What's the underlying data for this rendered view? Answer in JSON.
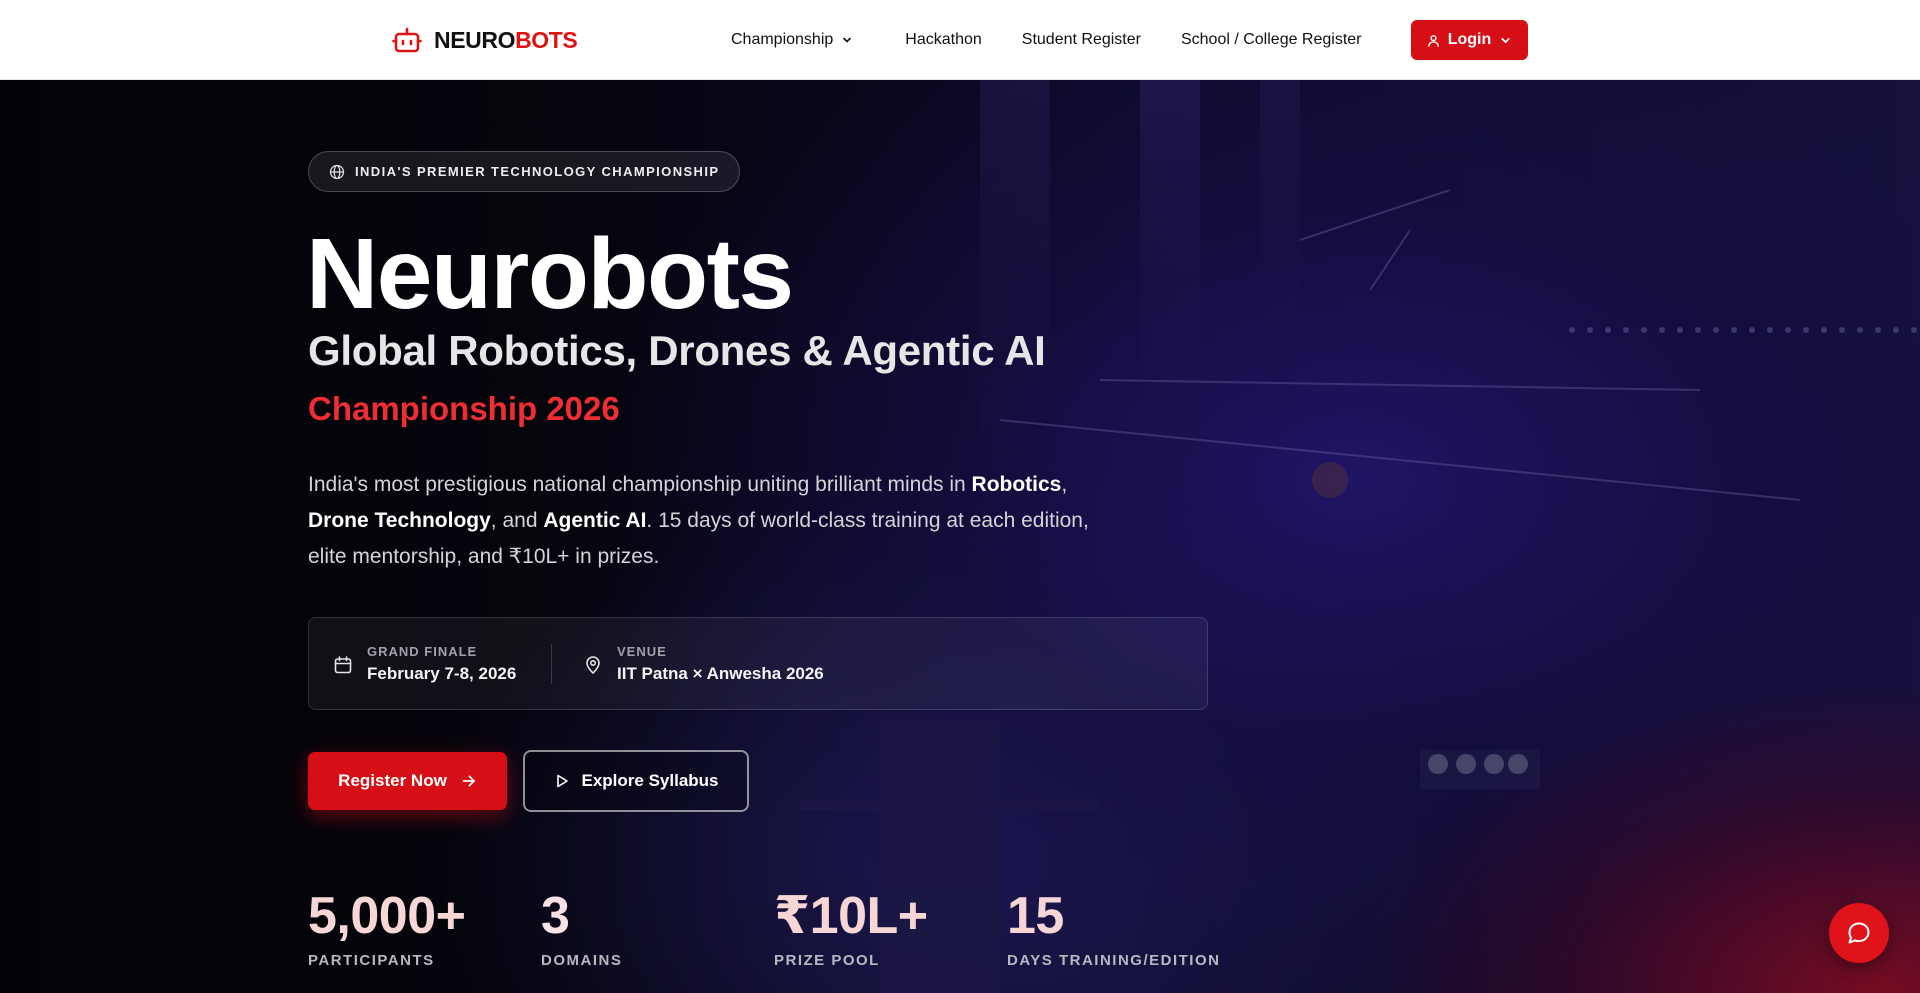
{
  "nav": {
    "brand_prefix": "NEURO",
    "brand_suffix": "BOTS",
    "links": [
      {
        "label": "Championship"
      },
      {
        "label": "Hackathon"
      },
      {
        "label": "Student Register"
      },
      {
        "label": "School / College Register"
      }
    ],
    "login_label": "Login"
  },
  "hero": {
    "tagline": "INDIA'S PREMIER TECHNOLOGY CHAMPIONSHIP",
    "title": "Neurobots",
    "subtitle": "Global Robotics, Drones & Agentic AI",
    "edition": "Championship 2026",
    "description": {
      "part1": "India's most prestigious national championship uniting brilliant minds in ",
      "b1": "Robotics",
      "part2": ", ",
      "b2": "Drone Technology",
      "part3": ", and ",
      "b3": "Agentic AI",
      "part4": ". 15 days of world-class training at each edition, elite mentorship, and ₹10L+ in prizes."
    },
    "info": {
      "finale_label": "GRAND FINALE",
      "finale_value": "February 7-8, 2026",
      "venue_label": "VENUE",
      "venue_value": "IIT Patna × Anwesha 2026"
    },
    "cta_primary": "Register Now",
    "cta_secondary": "Explore Syllabus",
    "stats": [
      {
        "value": "5,000+",
        "label": "PARTICIPANTS"
      },
      {
        "value": "3",
        "label": "DOMAINS"
      },
      {
        "value": "₹10L+",
        "label": "PRIZE POOL"
      },
      {
        "value": "15",
        "label": "DAYS TRAINING/EDITION"
      }
    ]
  },
  "colors": {
    "accent": "#dc1414",
    "edition_text": "#ef2e33"
  },
  "icons": {
    "logo": "robot-icon",
    "tagline": "globe-icon",
    "finale": "calendar-icon",
    "venue": "map-pin-icon",
    "login": "user-icon",
    "chat": "chat-bubble-icon"
  }
}
